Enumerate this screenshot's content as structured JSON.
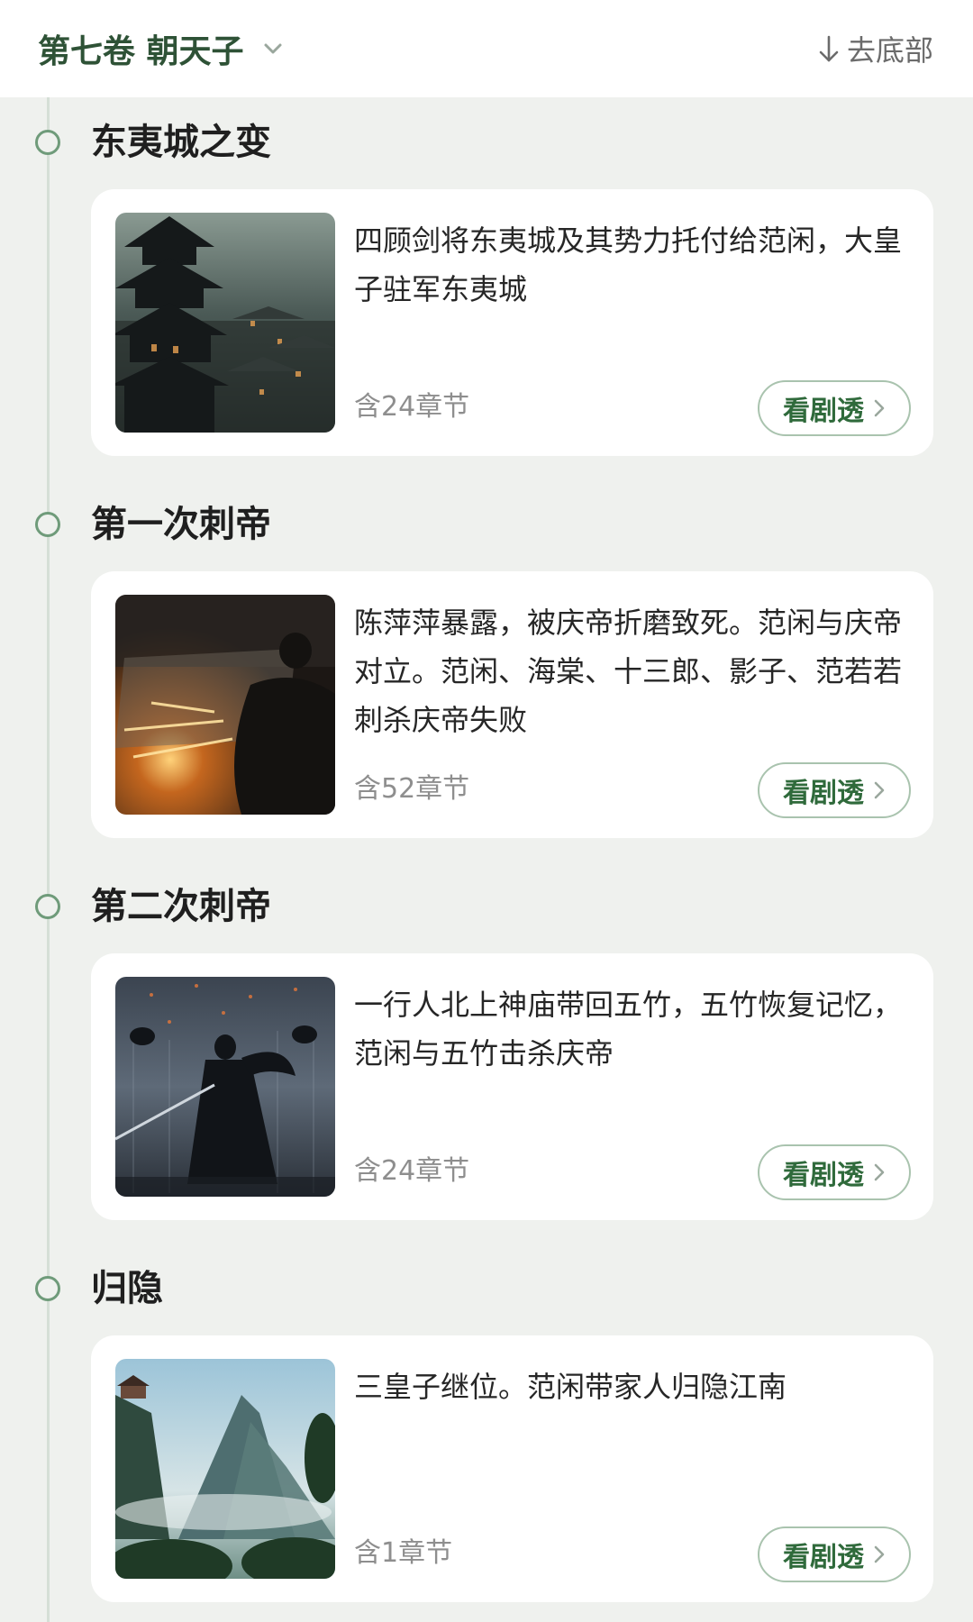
{
  "header": {
    "volume_title": "第七卷 朝天子",
    "go_bottom_label": "去底部"
  },
  "sections": [
    {
      "title": "东夷城之变",
      "description": "四顾剑将东夷城及其势力托付给范闲，大皇子驻军东夷城",
      "chapter_count": "含24章节",
      "button_label": "看剧透",
      "image": "pagoda-city-night"
    },
    {
      "title": "第一次刺帝",
      "description": "陈萍萍暴露，被庆帝折磨致死。范闲与庆帝对立。范闲、海棠、十三郎、影子、范若若刺杀庆帝失败",
      "chapter_count": "含52章节",
      "button_label": "看剧透",
      "image": "swordsman-sparks"
    },
    {
      "title": "第二次刺帝",
      "description": "一行人北上神庙带回五竹，五竹恢复记忆，范闲与五竹击杀庆帝",
      "chapter_count": "含24章节",
      "button_label": "看剧透",
      "image": "warrior-in-rain"
    },
    {
      "title": "归隐",
      "description": "三皇子继位。范闲带家人归隐江南",
      "chapter_count": "含1章节",
      "button_label": "看剧透",
      "image": "misty-mountains"
    }
  ],
  "colors": {
    "accent": "#2f6a3b",
    "timeline": "#6f9b7a",
    "background": "#eff1ee"
  }
}
